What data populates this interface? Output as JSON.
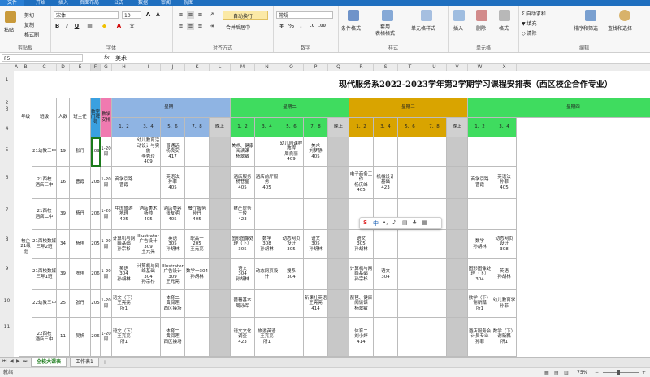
{
  "menu": {
    "file": "文件",
    "tabs": [
      "开始",
      "插入",
      "页面布局",
      "公式",
      "数据",
      "审阅",
      "视图"
    ]
  },
  "ribbon": {
    "clipboard": {
      "paste": "粘贴",
      "cut": "剪切",
      "copy": "复制",
      "format_painter": "格式刷",
      "label": "剪贴板"
    },
    "font": {
      "name": "宋体",
      "size": "10",
      "label": "字体"
    },
    "alignment": {
      "wrap": "自动换行",
      "merge": "合并后居中",
      "label": "对齐方式"
    },
    "number": {
      "format": "常规",
      "label": "数字"
    },
    "styles": {
      "conditional": "条件格式",
      "table": "套用\n表格格式",
      "cell": "单元格样式",
      "label": "样式"
    },
    "cells": {
      "insert": "插入",
      "delete": "删除",
      "format": "格式",
      "label": "单元格"
    },
    "editing": {
      "autosum": "自动求和",
      "fill": "填充",
      "clear": "清除",
      "sort": "排序和筛选",
      "find": "查找和选择",
      "label": "编辑"
    }
  },
  "formula_bar": {
    "name_box": "F5",
    "fx": "fx",
    "content": "美术"
  },
  "columns": [
    "A",
    "B",
    "C",
    "D",
    "E",
    "F",
    "G",
    "H",
    "I",
    "J",
    "K",
    "L",
    "M",
    "N",
    "O",
    "P",
    "Q",
    "R",
    "S",
    "T",
    "U",
    "V",
    "W",
    "X"
  ],
  "rows": [
    "1",
    "2",
    "3",
    "4",
    "5",
    "6",
    "7",
    "8",
    "9",
    "10",
    "11"
  ],
  "sheet": {
    "title": "现代服务系2022-2023学年第2学期学习课程安排表（西区校企合作专业）",
    "headers": {
      "grade": "年级",
      "class": "班级",
      "count": "人数",
      "teacher": "班主任",
      "room": "教室门牌号",
      "weeks": "教学安排"
    },
    "days": [
      "星期一",
      "星期二",
      "星期三",
      "星期四"
    ],
    "periods": [
      "1、2",
      "3、4",
      "5、6",
      "7、8",
      "晚上"
    ],
    "grade_label": "校企21级班",
    "rows": [
      {
        "class": "21幼教三中",
        "count": "19",
        "teacher": "张丹",
        "room": "209",
        "weeks": "1-20周",
        "mon": [
          "",
          "幼儿教育活动设计与实施\n李秀玲\n409",
          "普通话\n杨良安\n417",
          "",
          ""
        ],
        "tue": [
          "美术、健康\n阅读课\n杨翠敏",
          "",
          "幼儿园课程\n教程\n周良丽\n409",
          "美术\n刘梦静\n405",
          ""
        ],
        "wed": [
          "",
          "",
          "",
          "",
          ""
        ],
        "thu": [
          "",
          "",
          "",
          "幼儿教育活动设计与实施\n李秀玲\n409/美术",
          ""
        ]
      },
      {
        "class": "21西校\n酒店三中",
        "count": "16",
        "teacher": "曹霞",
        "room": "208",
        "weeks": "1-20周",
        "mon": [
          "商学引路\n曹霞",
          "",
          "英语法\n孙菲\n405",
          "",
          ""
        ],
        "tue": [
          "酒店服务\n杨苍星\n405",
          "酒店前厅服务\n405",
          "",
          "",
          ""
        ],
        "wed": [
          "电子商务工作\n杨庆峰\n405",
          "机械设计\n基础\n423",
          "",
          "",
          ""
        ],
        "thu": [
          "商学引路\n曹霞",
          "英语法\n孙菲\n405",
          "酒店英语\n杨庆峰\n208",
          "",
          ""
        ]
      },
      {
        "class": "21西校\n酒店二中",
        "count": "39",
        "teacher": "杨丹",
        "room": "206",
        "weeks": "1-20周",
        "mon": [
          "中国旅游\n地理\n405",
          "酒店美术\n杨帅\n405",
          "酒店美容\n张友明\n405",
          "餐厅服务\n孙丹\n405",
          ""
        ],
        "tue": [
          "财产房务\n王俊\n423",
          "",
          "",
          "",
          ""
        ],
        "wed": [
          "",
          "",
          "",
          "",
          ""
        ],
        "thu": [
          "",
          "",
          "酒店服务\n孙菲",
          "客厅服务\n孙丹",
          ""
        ]
      },
      {
        "class": "21西校数媒三年2班",
        "count": "34",
        "teacher": "杨伟",
        "room": "205",
        "weeks": "1-20周",
        "mon": [
          "计算机与网\n络基础\n孙宗杉",
          "Illustrator\n广告设计\n309\n王元亮",
          "英语\n305\n孙胡林",
          "职高一\n205\n王元亮",
          ""
        ],
        "tue": [
          "图形图像处\n理（下）\n305",
          "数学\n308\n孙胡林",
          "动态网页\n设计\n305",
          "语文\n305\n孙胡林",
          ""
        ],
        "wed": [
          "语文\n305\n孙胡林",
          "",
          "",
          "",
          ""
        ],
        "thu": [
          "数学\n孙胡林",
          "动态网页\n设计\n308",
          "英语\n孙胡林",
          "Illustrator\n广告设计\n309\n王元亮",
          ""
        ]
      },
      {
        "class": "21西校数媒三年1班",
        "count": "39",
        "teacher": "陈伟",
        "room": "206",
        "weeks": "1-20周",
        "mon": [
          "英语\n304\n孙胡林",
          "计算机与网\n络基础\n304\n孙宗杉",
          "Illustrator\n广告设计\n309\n王元亮",
          "数学一304\n孙胡林",
          ""
        ],
        "tue": [
          "语文\n304\n孙胡林",
          "动态网页设\n计",
          "搜系\n304",
          "",
          ""
        ],
        "wed": [
          "计算机与网\n络基础\n孙宗杉",
          "语文\n304",
          "",
          "",
          ""
        ],
        "thu": [
          "图形图像处\n理（下）\n304",
          "英语\n孙胡林",
          "数学\n304\n孙胡林",
          "Illustrator\n广告设计\n309",
          ""
        ]
      },
      {
        "class": "22幼教三中",
        "count": "25",
        "teacher": "张丹",
        "room": "205",
        "weeks": "1-20周",
        "mon": [
          "语文（下）\n王亮亮\n所1",
          "",
          "体育二\n黄润莲\n西区操场",
          "",
          ""
        ],
        "tue": [
          "琵琶基本\n周泳军",
          "",
          "",
          "新课社英语\n王亮亮\n414",
          ""
        ],
        "wed": [
          "琵琶、健康\n阅读课\n杨翠敏",
          "",
          "",
          "",
          ""
        ],
        "thu": [
          "数学（下）\n谢新瓢\n所1",
          "幼儿教育学\n孙菲",
          "新课社英语\n王亮亮\n414",
          "",
          ""
        ]
      },
      {
        "class": "22西校\n酒店三中",
        "count": "11",
        "teacher": "吴帆",
        "room": "206",
        "weeks": "1-20周",
        "mon": [
          "语文（下）\n王亮亮\n所1",
          "",
          "体育二\n黄润莲\n西区操场",
          "",
          ""
        ],
        "tue": [
          "语文文化\n调查\n423",
          "旅游英语\n王亮亮\n所1",
          "",
          "",
          ""
        ],
        "wed": [
          "体育二\n刘小婷\n414",
          "",
          "",
          "",
          ""
        ],
        "thu": [
          "酒店服务会\n计员专业\n孙菲",
          "数学（下）\n谢新瓢\n所1",
          "英语\n王亮亮",
          "",
          ""
        ]
      }
    ]
  },
  "sheet_tabs": [
    "全校大课表",
    "工作表1"
  ],
  "status": {
    "left": "就绪",
    "zoom": "75%"
  },
  "ime": {
    "brand": "S",
    "mode": "中"
  }
}
